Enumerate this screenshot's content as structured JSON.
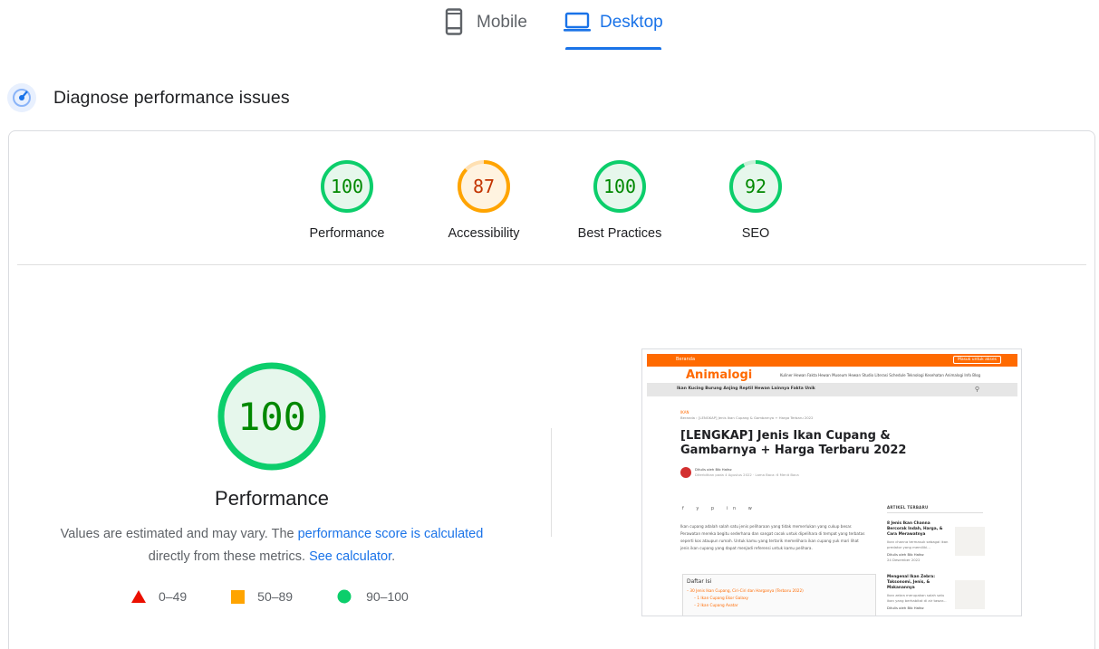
{
  "tabs": {
    "mobile": {
      "label": "Mobile",
      "icon": "smartphone-icon"
    },
    "desktop": {
      "label": "Desktop",
      "icon": "laptop-icon",
      "selected": true
    }
  },
  "section": {
    "title": "Diagnose performance issues",
    "icon": "speedometer-icon"
  },
  "scores": [
    {
      "label": "Performance",
      "value": 100,
      "status": "pass"
    },
    {
      "label": "Accessibility",
      "value": 87,
      "status": "average"
    },
    {
      "label": "Best Practices",
      "value": 100,
      "status": "pass"
    },
    {
      "label": "SEO",
      "value": 92,
      "status": "pass"
    }
  ],
  "performance": {
    "score": 100,
    "title": "Performance",
    "note_prefix": "Values are estimated and may vary. The ",
    "note_link1": "performance score is calculated",
    "note_middle": " directly from these metrics. ",
    "note_link2": "See calculator",
    "note_suffix": "."
  },
  "legend": [
    {
      "range": "0–49",
      "shape": "triangle",
      "color": "#eb0f00"
    },
    {
      "range": "50–89",
      "shape": "square",
      "color": "#ffa400"
    },
    {
      "range": "90–100",
      "shape": "circle",
      "color": "#0cce6b"
    }
  ],
  "colors": {
    "pass_stroke": "#0cce6b",
    "pass_fill": "#e6f7ec",
    "pass_text": "#008800",
    "average_stroke": "#ffa400",
    "average_fill": "#fff3e0",
    "average_text": "#c33300",
    "accent": "#1a73e8"
  },
  "thumbnail": {
    "topbar_home": "Beranda",
    "topbar_button": "Masuk untuk akses",
    "logo": "Animalogi",
    "nav": "Kuliner Hewan   Fakta Hewan   Museum Hewan   Studio Literasi   Schedule   Teknologi   Kesehatan   Animalogi   Info Blog",
    "categories": "Ikan   Kucing   Burung   Anjing   Reptil   Hewan Lainnya   Fakta Unik",
    "crumb_tag": "IKAN",
    "crumb_path": "Beranda › [LENGKAP] Jenis Ikan Cupang & Gambarnya + Harga Terbaru 2022",
    "headline": "[LENGKAP] Jenis Ikan Cupang & Gambarnya + Harga Terbaru 2022",
    "author": "Ditulis oleh Bib Hafaz",
    "author_meta": "Diterbitkan pada 4 Agustus 2022 · Lama Baca: 6 Menit Baca",
    "share": "f  y  p  in  w",
    "paragraph": "Ikan cupang adalah salah satu jenis peliharaan yang tidak memerlukan yang cukup besar. Perawatan mereka begitu sederhana dan sangat cocok untuk dipelihara di tempat yang terbatas seperti kos ataupun rumah. Untuk kamu yang tertarik memelihara ikan cupang yuk mari lihat jenis ikan cupang yang dapat menjadi referensi untuk kamu pelihara.",
    "toc_title": "Daftar Isi",
    "toc_items": [
      "– 30 Jenis Ikan Cupang, Ciri-Ciri dan Harganya (Terbaru 2022)",
      "   – 1 Ikan Cupang Ekor Galaxy",
      "   – 2 Ikan Cupang Avatar"
    ],
    "sidebar_heading": "ARTIKEL TERBARU",
    "sidebar_articles": [
      {
        "title": "8 Jenis Ikan Channa Bercorak Indah, Harga, & Cara Merawatnya",
        "desc": "Ikan channa termasuk sebagai ikan predator yang memiliki...",
        "by": "Ditulis oleh Bib Hafaz",
        "date": "24 Desember 2022"
      },
      {
        "title": "Mengenal Ikan Zebra: Taksonomi, Jenis, & Makanannya",
        "desc": "Ikan zebra merupakan salah satu ikan yang berhabitat di air tawar...",
        "by": "Ditulis oleh Bib Hafaz",
        "date": ""
      }
    ]
  }
}
